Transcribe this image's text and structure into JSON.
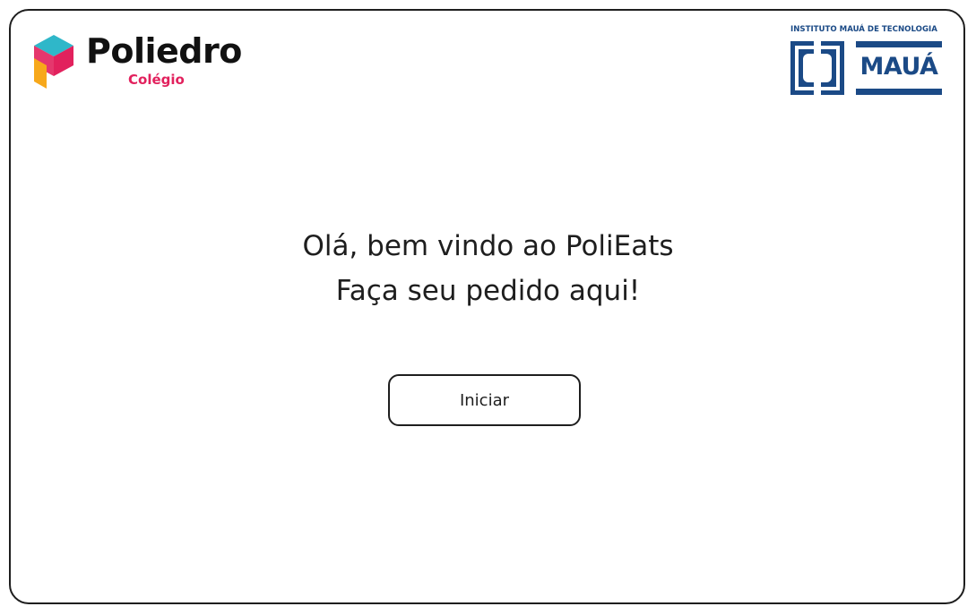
{
  "brand_left": {
    "name": "Poliedro",
    "subtitle": "Colégio",
    "colors": {
      "cube_top": "#2fb7c9",
      "cube_left": "#f7a81b",
      "cube_right": "#e2215d",
      "subtitle": "#e2215d"
    }
  },
  "brand_right": {
    "caption": "INSTITUTO MAUÁ DE TECNOLOGIA",
    "name": "MAUÁ",
    "color": "#1b4a86"
  },
  "welcome": {
    "line1": "Olá, bem vindo ao PoliEats",
    "line2": "Faça seu pedido aqui!"
  },
  "actions": {
    "start_label": "Iniciar"
  }
}
